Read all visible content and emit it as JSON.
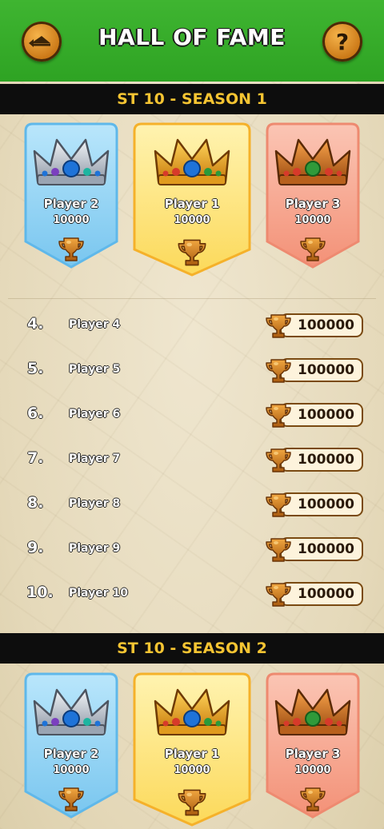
{
  "header": {
    "title": "HALL OF FAME",
    "back_icon": "pyramid-back-icon",
    "help_icon": "question-mark-icon"
  },
  "seasons": [
    {
      "title": "ST 10 - SEASON 1",
      "podium": [
        {
          "name": "Player 2",
          "score": "10000",
          "crown": "silver"
        },
        {
          "name": "Player 1",
          "score": "10000",
          "crown": "gold"
        },
        {
          "name": "Player 3",
          "score": "10000",
          "crown": "bronze"
        }
      ],
      "ranks": [
        {
          "rank": "4.",
          "name": "Player 4",
          "score": "100000"
        },
        {
          "rank": "5.",
          "name": "Player 5",
          "score": "100000"
        },
        {
          "rank": "6.",
          "name": "Player 6",
          "score": "100000"
        },
        {
          "rank": "7.",
          "name": "Player 7",
          "score": "100000"
        },
        {
          "rank": "8.",
          "name": "Player 8",
          "score": "100000"
        },
        {
          "rank": "9.",
          "name": "Player 9",
          "score": "100000"
        },
        {
          "rank": "10.",
          "name": "Player 10",
          "score": "100000"
        }
      ]
    },
    {
      "title": "ST 10 - SEASON 2",
      "podium": [
        {
          "name": "Player 2",
          "score": "10000",
          "crown": "silver"
        },
        {
          "name": "Player 1",
          "score": "10000",
          "crown": "gold"
        },
        {
          "name": "Player 3",
          "score": "10000",
          "crown": "bronze"
        }
      ]
    }
  ],
  "colors": {
    "header": "#3fb531",
    "season_text": "#f5c432",
    "silver_banner": "#8dd3f5",
    "gold_banner": "#fde683",
    "bronze_banner": "#f7a791"
  }
}
